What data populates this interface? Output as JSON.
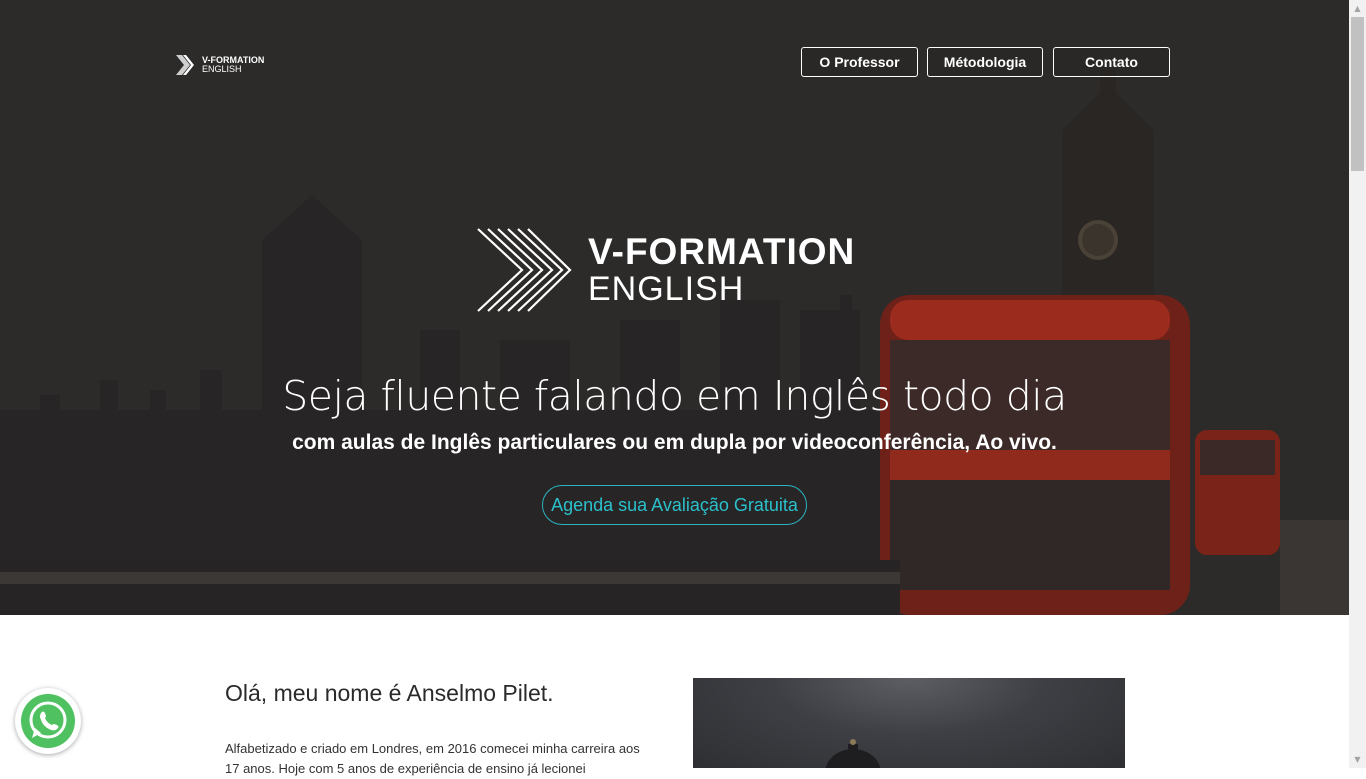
{
  "brand": {
    "small_line1": "V-FORMATION",
    "small_line2": "ENGLISH",
    "big_line1": "V-FORMATION",
    "big_line2": "ENGLISH"
  },
  "nav": {
    "items": [
      "O Professor",
      "Métodologia",
      "Contato"
    ]
  },
  "hero": {
    "headline": "Seja fluente falando em Inglês todo dia",
    "subline": "com aulas de Inglês particulares ou em dupla por videoconferência, Ao vivo.",
    "cta": "Agenda sua Avaliação Gratuita",
    "image_description": "London skyline with Big Ben and red double-decker bus, darkened"
  },
  "about": {
    "title": "Olá, meu nome é Anselmo Pilet.",
    "text": "Alfabetizado e criado em Londres, em 2016 comecei minha carreira aos 17 anos. Hoje com 5 anos de experiência de ensino já lecionei"
  },
  "colors": {
    "accent": "#2bc0cc",
    "hero_overlay": "#2d2b2a",
    "bus_red": "#b8301f"
  },
  "icons": {
    "whatsapp": "whatsapp-icon",
    "logo": "chevron-stripes-logo"
  }
}
